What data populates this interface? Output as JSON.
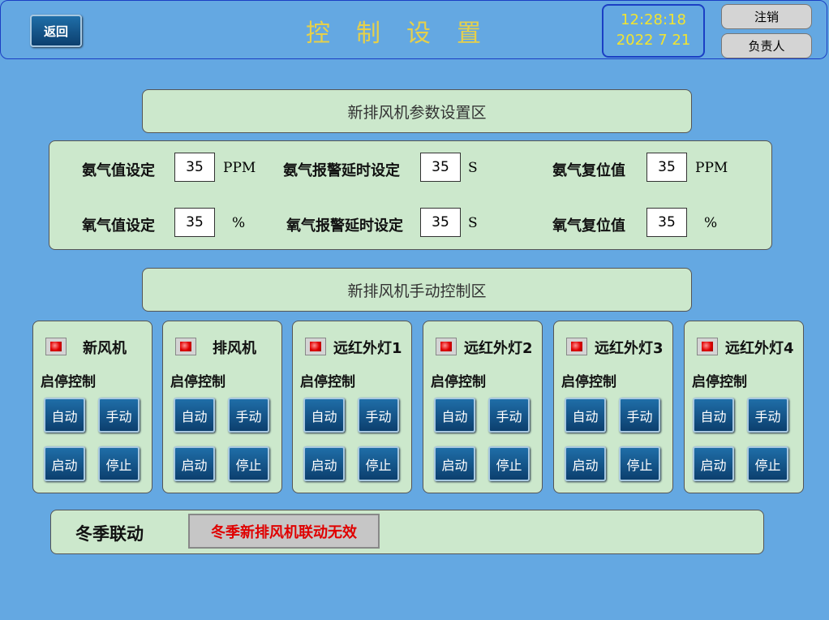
{
  "header": {
    "back_label": "返回",
    "title": "控制设置",
    "clock": {
      "time": "12:28:18",
      "date": "2022  7 21"
    },
    "logout_label": "注销",
    "owner_label": "负责人"
  },
  "param_section": {
    "title": "新排风机参数设置区",
    "rows": [
      [
        {
          "label": "氨气值设定",
          "value": "35",
          "unit": "PPM"
        },
        {
          "label": "氨气报警延时设定",
          "value": "35",
          "unit": "S"
        },
        {
          "label": "氨气复位值",
          "value": "35",
          "unit": "PPM"
        }
      ],
      [
        {
          "label": "氧气值设定",
          "value": "35",
          "unit": "%"
        },
        {
          "label": "氧气报警延时设定",
          "value": "35",
          "unit": "S"
        },
        {
          "label": "氧气复位值",
          "value": "35",
          "unit": "%"
        }
      ]
    ]
  },
  "manual_section": {
    "title": "新排风机手动控制区",
    "devices": [
      {
        "name": "新风机",
        "sub": "启停控制",
        "auto": "自动",
        "manual": "手动",
        "start": "启动",
        "stop": "停止",
        "indicator": "red"
      },
      {
        "name": "排风机",
        "sub": "启停控制",
        "auto": "自动",
        "manual": "手动",
        "start": "启动",
        "stop": "停止",
        "indicator": "red"
      },
      {
        "name": "远红外灯1",
        "sub": "启停控制",
        "auto": "自动",
        "manual": "手动",
        "start": "启动",
        "stop": "停止",
        "indicator": "red"
      },
      {
        "name": "远红外灯2",
        "sub": "启停控制",
        "auto": "自动",
        "manual": "手动",
        "start": "启动",
        "stop": "停止",
        "indicator": "red"
      },
      {
        "name": "远红外灯3",
        "sub": "启停控制",
        "auto": "自动",
        "manual": "手动",
        "start": "启动",
        "stop": "停止",
        "indicator": "red"
      },
      {
        "name": "远红外灯4",
        "sub": "启停控制",
        "auto": "自动",
        "manual": "手动",
        "start": "启动",
        "stop": "停止",
        "indicator": "red"
      }
    ]
  },
  "winter": {
    "label": "冬季联动",
    "status": "冬季新排风机联动无效"
  },
  "colors": {
    "background": "#64a8e2",
    "panel": "#cce8cc",
    "title_text": "#e6d04a",
    "clock_text": "#f2e430",
    "button": "#0c3f6e",
    "indicator_red": "#e00000",
    "status_red": "#e00000"
  }
}
